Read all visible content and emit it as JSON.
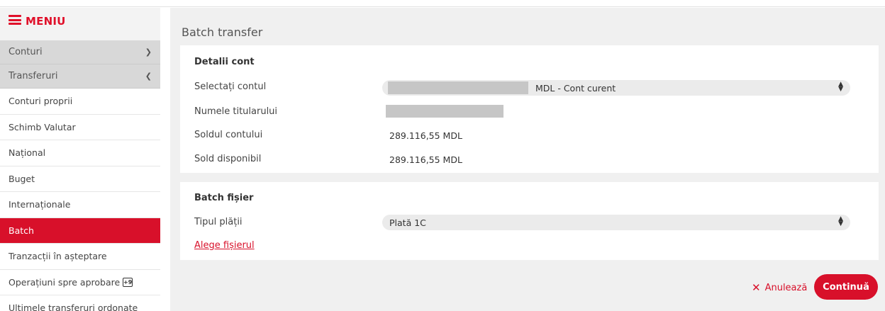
{
  "menu": {
    "label": "MENIU"
  },
  "sidebar": {
    "groups": [
      {
        "label": "Conturi",
        "chevron": "chevron-down-icon"
      },
      {
        "label": "Transferuri",
        "chevron": "chevron-up-icon"
      }
    ],
    "items": [
      {
        "label": "Conturi proprii"
      },
      {
        "label": "Schimb Valutar"
      },
      {
        "label": "Național"
      },
      {
        "label": "Buget"
      },
      {
        "label": "Internaționale"
      },
      {
        "label": "Batch"
      },
      {
        "label": "Tranzacții în așteptare"
      },
      {
        "label": "Operațiuni spre aprobare",
        "badge": "+9"
      },
      {
        "label": "Ultimele transferuri ordonate"
      }
    ],
    "active_index": 5
  },
  "main": {
    "title": "Batch transfer",
    "account_details": {
      "title": "Detalii cont",
      "select_label": "Selectați contul",
      "select_value": "MDL - Cont curent",
      "holder_label": "Numele titularului",
      "balance_label": "Soldul contului",
      "balance_value": "289.116,55 MDL",
      "available_label": "Sold disponibil",
      "available_value": "289.116,55 MDL"
    },
    "batch_file": {
      "title": "Batch fișier",
      "payment_type_label": "Tipul plății",
      "payment_type_value": "Plată 1C",
      "choose_file": "Alege fișierul"
    },
    "actions": {
      "cancel": "Anulează",
      "continue": "Continuă"
    }
  },
  "colors": {
    "accent": "#d8102a",
    "sidebar_group_bg": "#d8d8d8",
    "main_bg": "#f0f0f0"
  }
}
